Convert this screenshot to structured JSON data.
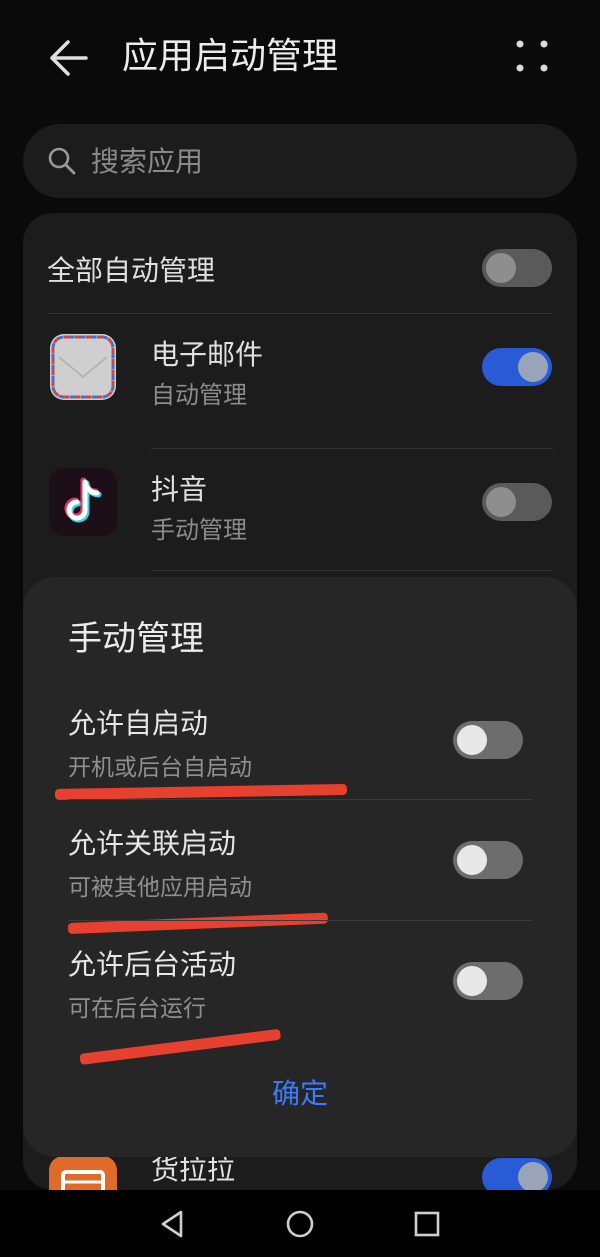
{
  "header": {
    "title": "应用启动管理",
    "back_icon": "back-arrow-icon",
    "more_icon": "more-dots-icon"
  },
  "search": {
    "placeholder": "搜索应用",
    "icon": "search-icon"
  },
  "list": {
    "all_label": "全部自动管理",
    "all_enabled": false,
    "apps": [
      {
        "name": "电子邮件",
        "status": "自动管理",
        "enabled": true,
        "icon": "email-app-icon"
      },
      {
        "name": "抖音",
        "status": "手动管理",
        "enabled": false,
        "icon": "douyin-app-icon"
      },
      {
        "name": "货拉拉",
        "enabled": true,
        "icon": "huolala-app-icon"
      }
    ]
  },
  "dialog": {
    "title": "手动管理",
    "options": [
      {
        "title": "允许自启动",
        "subtitle": "开机或后台自启动",
        "enabled": false
      },
      {
        "title": "允许关联启动",
        "subtitle": "可被其他应用启动",
        "enabled": false
      },
      {
        "title": "允许后台活动",
        "subtitle": "可在后台运行",
        "enabled": false
      }
    ],
    "confirm_label": "确定"
  },
  "colors": {
    "accent": "#3d7af7",
    "toggle_on": "#2a5bd7",
    "annotation_red": "#e8402e",
    "douyin_bg": "#1d0f18",
    "huolala_bg": "#e06a28"
  },
  "nav": {
    "back_icon": "triangle-back-icon",
    "home_icon": "circle-home-icon",
    "recents_icon": "square-recents-icon"
  }
}
